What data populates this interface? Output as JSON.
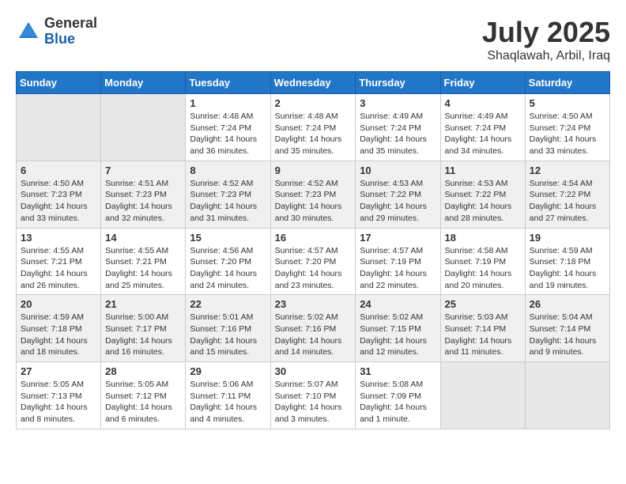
{
  "logo": {
    "general": "General",
    "blue": "Blue"
  },
  "title": {
    "month": "July 2025",
    "location": "Shaqlawah, Arbil, Iraq"
  },
  "headers": [
    "Sunday",
    "Monday",
    "Tuesday",
    "Wednesday",
    "Thursday",
    "Friday",
    "Saturday"
  ],
  "weeks": [
    [
      {
        "day": "",
        "info": ""
      },
      {
        "day": "",
        "info": ""
      },
      {
        "day": "1",
        "info": "Sunrise: 4:48 AM\nSunset: 7:24 PM\nDaylight: 14 hours and 36 minutes."
      },
      {
        "day": "2",
        "info": "Sunrise: 4:48 AM\nSunset: 7:24 PM\nDaylight: 14 hours and 35 minutes."
      },
      {
        "day": "3",
        "info": "Sunrise: 4:49 AM\nSunset: 7:24 PM\nDaylight: 14 hours and 35 minutes."
      },
      {
        "day": "4",
        "info": "Sunrise: 4:49 AM\nSunset: 7:24 PM\nDaylight: 14 hours and 34 minutes."
      },
      {
        "day": "5",
        "info": "Sunrise: 4:50 AM\nSunset: 7:24 PM\nDaylight: 14 hours and 33 minutes."
      }
    ],
    [
      {
        "day": "6",
        "info": "Sunrise: 4:50 AM\nSunset: 7:23 PM\nDaylight: 14 hours and 33 minutes."
      },
      {
        "day": "7",
        "info": "Sunrise: 4:51 AM\nSunset: 7:23 PM\nDaylight: 14 hours and 32 minutes."
      },
      {
        "day": "8",
        "info": "Sunrise: 4:52 AM\nSunset: 7:23 PM\nDaylight: 14 hours and 31 minutes."
      },
      {
        "day": "9",
        "info": "Sunrise: 4:52 AM\nSunset: 7:23 PM\nDaylight: 14 hours and 30 minutes."
      },
      {
        "day": "10",
        "info": "Sunrise: 4:53 AM\nSunset: 7:22 PM\nDaylight: 14 hours and 29 minutes."
      },
      {
        "day": "11",
        "info": "Sunrise: 4:53 AM\nSunset: 7:22 PM\nDaylight: 14 hours and 28 minutes."
      },
      {
        "day": "12",
        "info": "Sunrise: 4:54 AM\nSunset: 7:22 PM\nDaylight: 14 hours and 27 minutes."
      }
    ],
    [
      {
        "day": "13",
        "info": "Sunrise: 4:55 AM\nSunset: 7:21 PM\nDaylight: 14 hours and 26 minutes."
      },
      {
        "day": "14",
        "info": "Sunrise: 4:55 AM\nSunset: 7:21 PM\nDaylight: 14 hours and 25 minutes."
      },
      {
        "day": "15",
        "info": "Sunrise: 4:56 AM\nSunset: 7:20 PM\nDaylight: 14 hours and 24 minutes."
      },
      {
        "day": "16",
        "info": "Sunrise: 4:57 AM\nSunset: 7:20 PM\nDaylight: 14 hours and 23 minutes."
      },
      {
        "day": "17",
        "info": "Sunrise: 4:57 AM\nSunset: 7:19 PM\nDaylight: 14 hours and 22 minutes."
      },
      {
        "day": "18",
        "info": "Sunrise: 4:58 AM\nSunset: 7:19 PM\nDaylight: 14 hours and 20 minutes."
      },
      {
        "day": "19",
        "info": "Sunrise: 4:59 AM\nSunset: 7:18 PM\nDaylight: 14 hours and 19 minutes."
      }
    ],
    [
      {
        "day": "20",
        "info": "Sunrise: 4:59 AM\nSunset: 7:18 PM\nDaylight: 14 hours and 18 minutes."
      },
      {
        "day": "21",
        "info": "Sunrise: 5:00 AM\nSunset: 7:17 PM\nDaylight: 14 hours and 16 minutes."
      },
      {
        "day": "22",
        "info": "Sunrise: 5:01 AM\nSunset: 7:16 PM\nDaylight: 14 hours and 15 minutes."
      },
      {
        "day": "23",
        "info": "Sunrise: 5:02 AM\nSunset: 7:16 PM\nDaylight: 14 hours and 14 minutes."
      },
      {
        "day": "24",
        "info": "Sunrise: 5:02 AM\nSunset: 7:15 PM\nDaylight: 14 hours and 12 minutes."
      },
      {
        "day": "25",
        "info": "Sunrise: 5:03 AM\nSunset: 7:14 PM\nDaylight: 14 hours and 11 minutes."
      },
      {
        "day": "26",
        "info": "Sunrise: 5:04 AM\nSunset: 7:14 PM\nDaylight: 14 hours and 9 minutes."
      }
    ],
    [
      {
        "day": "27",
        "info": "Sunrise: 5:05 AM\nSunset: 7:13 PM\nDaylight: 14 hours and 8 minutes."
      },
      {
        "day": "28",
        "info": "Sunrise: 5:05 AM\nSunset: 7:12 PM\nDaylight: 14 hours and 6 minutes."
      },
      {
        "day": "29",
        "info": "Sunrise: 5:06 AM\nSunset: 7:11 PM\nDaylight: 14 hours and 4 minutes."
      },
      {
        "day": "30",
        "info": "Sunrise: 5:07 AM\nSunset: 7:10 PM\nDaylight: 14 hours and 3 minutes."
      },
      {
        "day": "31",
        "info": "Sunrise: 5:08 AM\nSunset: 7:09 PM\nDaylight: 14 hours and 1 minute."
      },
      {
        "day": "",
        "info": ""
      },
      {
        "day": "",
        "info": ""
      }
    ]
  ]
}
